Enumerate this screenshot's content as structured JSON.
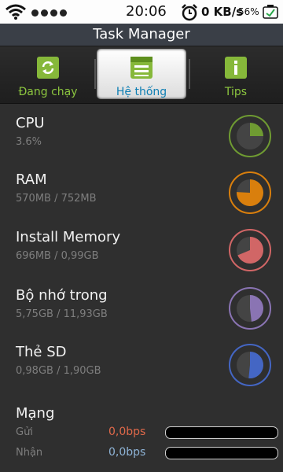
{
  "status_bar": {
    "time": "20:06",
    "network_speed": "0 KB/s",
    "battery_percent": "56%",
    "icons": [
      "wifi-icon",
      "signal-dots-icon",
      "alarm-clock-icon",
      "battery-icon"
    ]
  },
  "header": {
    "title": "Task Manager"
  },
  "tabs": [
    {
      "label": "Đang chạy",
      "icon": "refresh-icon",
      "active": false
    },
    {
      "label": "Hệ thống",
      "icon": "system-list-icon",
      "active": true
    },
    {
      "label": "Tips",
      "icon": "info-icon",
      "active": false
    }
  ],
  "resources": [
    {
      "name": "CPU",
      "usage": "3.6%",
      "fraction": 0.036,
      "color": "#6f9b32"
    },
    {
      "name": "RAM",
      "usage": "570MB / 752MB",
      "fraction": 0.758,
      "color": "#d97f0d"
    },
    {
      "name": "Install Memory",
      "usage": "696MB / 0,99GB",
      "fraction": 0.687,
      "color": "#d16666"
    },
    {
      "name": "Bộ nhớ trong",
      "usage": "5,75GB / 11,93GB",
      "fraction": 0.482,
      "color": "#8a74b3"
    },
    {
      "name": "Thẻ SD",
      "usage": "0,98GB / 1,90GB",
      "fraction": 0.516,
      "color": "#4466c4"
    }
  ],
  "network": {
    "title": "Mạng",
    "send_label": "Gửi",
    "send_value": "0,0bps",
    "send_color": "#e0694a",
    "send_fraction": 0,
    "receive_label": "Nhận",
    "receive_value": "0,0bps",
    "receive_color": "#8eb3d6",
    "receive_fraction": 0
  }
}
